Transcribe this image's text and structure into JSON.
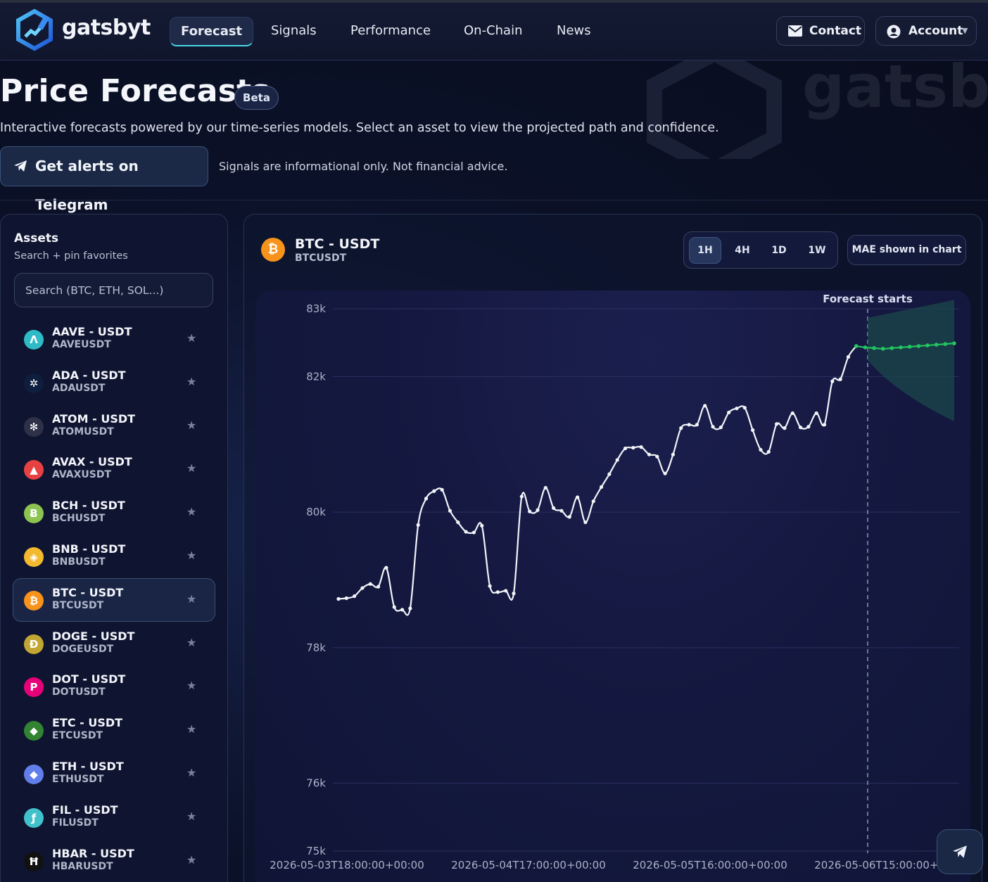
{
  "nav": {
    "brand": "gatsbyt",
    "links": [
      {
        "label": "Forecast",
        "active": true
      },
      {
        "label": "Signals"
      },
      {
        "label": "Performance"
      },
      {
        "label": "On-Chain"
      },
      {
        "label": "News"
      }
    ],
    "contact_label": "Contact",
    "account_label": "Account"
  },
  "hero": {
    "title": "Price Forecasts",
    "badge": "Beta",
    "subtitle": "Interactive forecasts powered by our time-series models. Select an asset to view the projected path and confidence.",
    "telegram_label": "Get alerts on Telegram",
    "disclaimer": "Signals are informational only. Not financial advice."
  },
  "sidebar": {
    "title": "Assets",
    "subtitle": "Search + pin favorites",
    "search_placeholder": "Search (BTC, ETH, SOL...)",
    "assets": [
      {
        "name": "AAVE - USDT",
        "symbol": "AAVEUSDT",
        "glyph": "Λ",
        "color": "#2ebac6"
      },
      {
        "name": "ADA - USDT",
        "symbol": "ADAUSDT",
        "glyph": "✲",
        "color": "#0d1e3e"
      },
      {
        "name": "ATOM - USDT",
        "symbol": "ATOMUSDT",
        "glyph": "✻",
        "color": "#2e3148"
      },
      {
        "name": "AVAX - USDT",
        "symbol": "AVAXUSDT",
        "glyph": "▲",
        "color": "#e84142"
      },
      {
        "name": "BCH - USDT",
        "symbol": "BCHUSDT",
        "glyph": "Ƀ",
        "color": "#8dc351"
      },
      {
        "name": "BNB - USDT",
        "symbol": "BNBUSDT",
        "glyph": "◈",
        "color": "#f3ba2f"
      },
      {
        "name": "BTC - USDT",
        "symbol": "BTCUSDT",
        "glyph": "₿",
        "color": "#f7931a",
        "active": true
      },
      {
        "name": "DOGE - USDT",
        "symbol": "DOGEUSDT",
        "glyph": "Ð",
        "color": "#c2a633"
      },
      {
        "name": "DOT - USDT",
        "symbol": "DOTUSDT",
        "glyph": "P",
        "color": "#e6007a"
      },
      {
        "name": "ETC - USDT",
        "symbol": "ETCUSDT",
        "glyph": "◆",
        "color": "#328332"
      },
      {
        "name": "ETH - USDT",
        "symbol": "ETHUSDT",
        "glyph": "◆",
        "color": "#627eea"
      },
      {
        "name": "FIL - USDT",
        "symbol": "FILUSDT",
        "glyph": "ƒ",
        "color": "#42c1ca"
      },
      {
        "name": "HBAR - USDT",
        "symbol": "HBARUSDT",
        "glyph": "Ħ",
        "color": "#111111"
      }
    ]
  },
  "panel": {
    "pair": "BTC - USDT",
    "symbol": "BTCUSDT",
    "timeframes": [
      "1H",
      "4H",
      "1D",
      "1W"
    ],
    "active_timeframe": "1H",
    "mae_label": "MAE shown in chart"
  },
  "chart_data": {
    "type": "line",
    "annotation": "Forecast starts",
    "yticks": [
      "83k",
      "82k",
      "80k",
      "78k",
      "76k",
      "75k"
    ],
    "ytick_values": [
      83000,
      82000,
      80000,
      78000,
      76000,
      75000
    ],
    "ylim": [
      75000,
      83000
    ],
    "xtick_labels": [
      "2026-05-03T18:00:00+00:00",
      "2026-05-04T17:00:00+00:00",
      "2026-05-05T16:00:00+00:00",
      "2026-05-06T15:00:00+00:00"
    ],
    "x_hours_per_tick": 23,
    "series": [
      {
        "role": "history",
        "color": "#f2f4f8",
        "values": [
          78720,
          78730,
          78760,
          78880,
          78940,
          78900,
          79180,
          78600,
          78560,
          78580,
          79810,
          80200,
          80310,
          80330,
          80020,
          79850,
          79710,
          79700,
          79800,
          78910,
          78820,
          78840,
          78800,
          80230,
          80010,
          80030,
          80360,
          80060,
          80020,
          79930,
          80220,
          79850,
          80160,
          80370,
          80560,
          80770,
          80940,
          80950,
          80960,
          80850,
          80820,
          80570,
          80850,
          81240,
          81290,
          81290,
          81570,
          81260,
          81250,
          81470,
          81530,
          81540,
          81210,
          80920,
          80890,
          81300,
          81240,
          81460,
          81250,
          81260,
          81460,
          81290,
          81930,
          81960,
          82290,
          82450
        ]
      },
      {
        "role": "forecast",
        "color": "#22c55e",
        "values": [
          82450,
          82430,
          82420,
          82410,
          82420,
          82430,
          82440,
          82450,
          82460,
          82470,
          82480,
          82490
        ]
      }
    ],
    "confidence_band": {
      "color": "#1b4a4c",
      "upper_end": 82560,
      "lower_end": 81340
    }
  }
}
